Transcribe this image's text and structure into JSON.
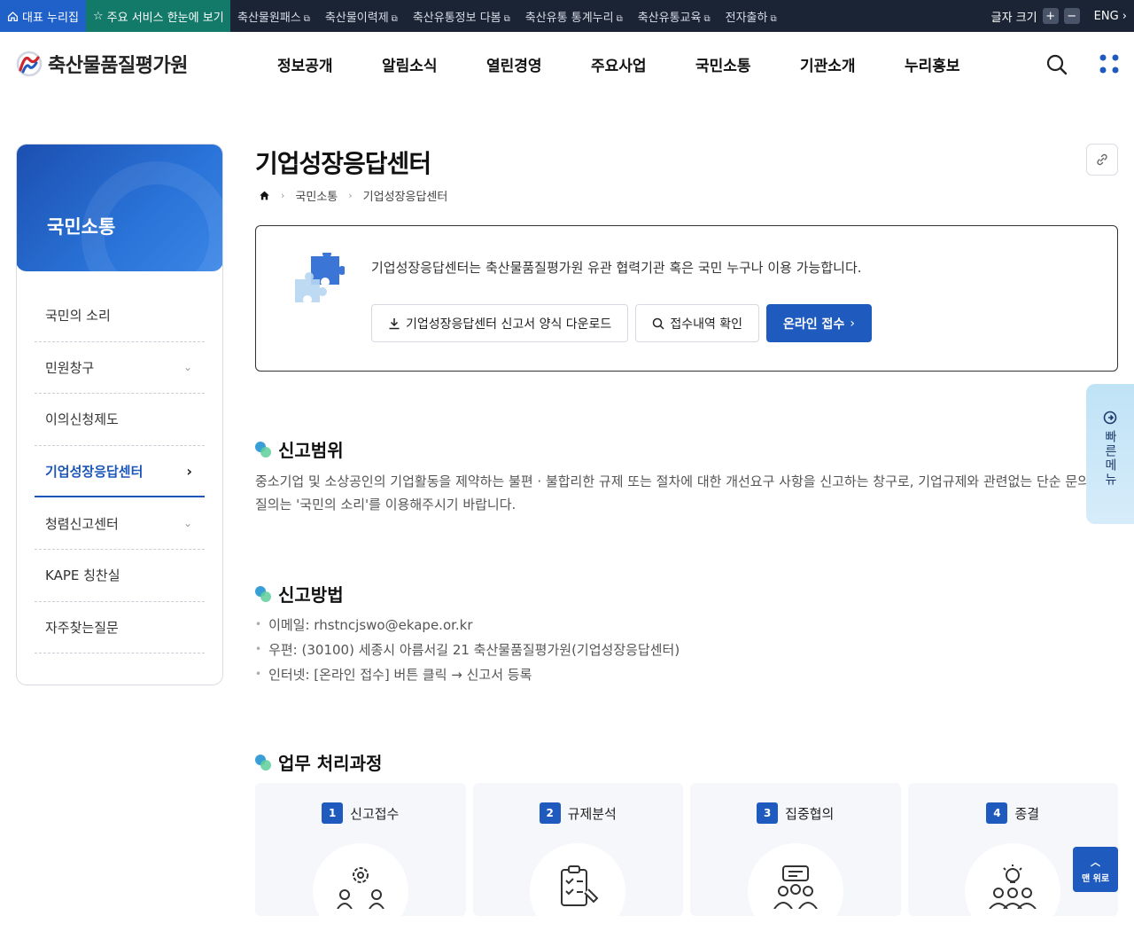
{
  "topbar": {
    "home_label": "대표 누리집",
    "services_label": "주요 서비스 한눈에 보기",
    "links": [
      "축산물원패스",
      "축산물이력제",
      "축산유통정보 다봄",
      "축산유통 통계누리",
      "축산유통교육",
      "전자출하"
    ],
    "font_size_label": "글자 크기",
    "plus": "+",
    "minus": "−",
    "lang": "ENG"
  },
  "header": {
    "logo_text": "축산물품질평가원",
    "nav": [
      "정보공개",
      "알림소식",
      "열린경영",
      "주요사업",
      "국민소통",
      "기관소개",
      "누리홍보"
    ]
  },
  "lnb": {
    "title": "국민소통",
    "items": [
      {
        "label": "국민의 소리",
        "chevron": ""
      },
      {
        "label": "민원창구",
        "chevron": "⌄"
      },
      {
        "label": "이의신청제도",
        "chevron": ""
      },
      {
        "label": "기업성장응답센터",
        "chevron": "›"
      },
      {
        "label": "청렴신고센터",
        "chevron": "⌄"
      },
      {
        "label": "KAPE 칭찬실",
        "chevron": ""
      },
      {
        "label": "자주찾는질문",
        "chevron": ""
      }
    ]
  },
  "page": {
    "title": "기업성장응답센터",
    "breadcrumb": [
      "국민소통",
      "기업성장응답센터"
    ]
  },
  "info": {
    "text": "기업성장응답센터는 축산물품질평가원 유관 협력기관 혹은 국민 누구나 이용 가능합니다.",
    "btn_download": "기업성장응답센터 신고서 양식 다운로드",
    "btn_check": "접수내역 확인",
    "btn_online": "온라인 접수"
  },
  "scope": {
    "title": "신고범위",
    "line1": "중소기업 및 소상공인의 기업활동을 제약하는 불편 · 불합리한 규제 또는 절차에 대한 개선요구 사항을 신고하는 창구로, 기업규제와 관련없는 단순 문의 및 각",
    "line2": "질의는 '국민의 소리'를 이용해주시기 바랍니다."
  },
  "method": {
    "title": "신고방법",
    "items": [
      "이메일: rhstncjswo@ekape.or.kr",
      "우편: (30100) 세종시 아름서길 21 축산물품질평가원(기업성장응답센터)",
      "인터넷: [온라인 접수] 버튼 클릭 → 신고서 등록"
    ]
  },
  "process": {
    "title": "업무 처리과정",
    "steps": [
      {
        "num": "1",
        "label": "신고접수"
      },
      {
        "num": "2",
        "label": "규제분석"
      },
      {
        "num": "3",
        "label": "집중협의"
      },
      {
        "num": "4",
        "label": "종결"
      }
    ]
  },
  "quick_menu": {
    "label": "빠른메뉴"
  },
  "to_top": {
    "label": "맨 위로"
  },
  "colors": {
    "primary": "#1f5bbf",
    "topbar": "#1b2434",
    "teal": "#137a6a"
  }
}
